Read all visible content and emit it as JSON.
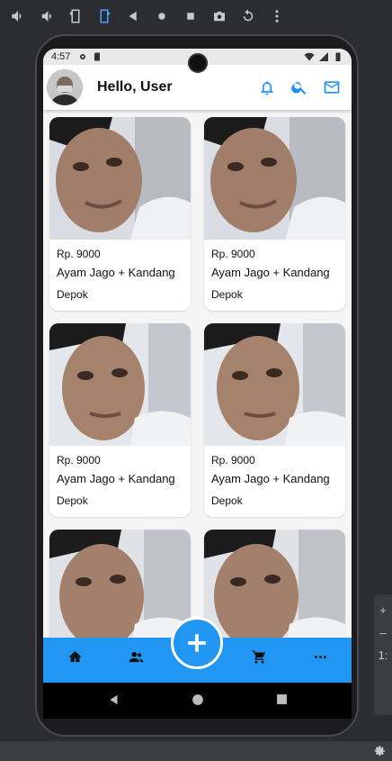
{
  "emulator": {
    "toolbar": [
      "volume-up-icon",
      "volume-down-icon",
      "rotate-left-icon",
      "rotate-right-icon",
      "back-icon",
      "home-icon",
      "overview-icon",
      "screenshot-icon",
      "replay-icon",
      "more-vert-icon"
    ],
    "side_panel": [
      "+",
      "–",
      "1:"
    ]
  },
  "status_bar": {
    "time": "4:57"
  },
  "header": {
    "greeting": "Hello, User"
  },
  "products": [
    {
      "price": "Rp. 9000",
      "title": "Ayam Jago + Kandang",
      "location": "Depok"
    },
    {
      "price": "Rp. 9000",
      "title": "Ayam Jago + Kandang",
      "location": "Depok"
    },
    {
      "price": "Rp. 9000",
      "title": "Ayam Jago + Kandang",
      "location": "Depok"
    },
    {
      "price": "Rp. 9000",
      "title": "Ayam Jago + Kandang",
      "location": "Depok"
    },
    {
      "price": "",
      "title": "",
      "location": ""
    },
    {
      "price": "",
      "title": "",
      "location": ""
    }
  ],
  "bottom_nav": {
    "items": [
      "home-icon",
      "people-icon",
      "add-icon",
      "cart-icon",
      "more-horiz-icon"
    ],
    "accent": "#2196f3"
  }
}
